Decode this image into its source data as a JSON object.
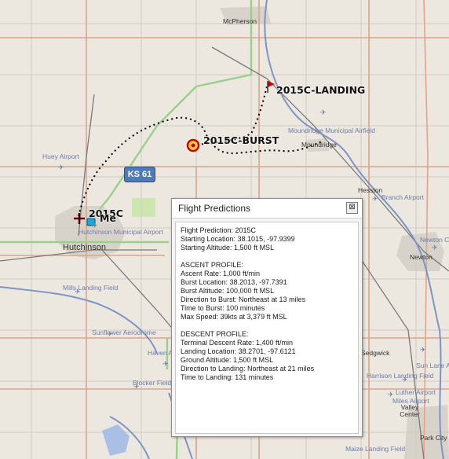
{
  "map": {
    "towns": {
      "mcpherson": "McPherson",
      "hutchinson": "Hutchinson",
      "hesston": "Hesston",
      "newton": "Newton",
      "moundridge": "Moundridge",
      "sedgwick": "Sedgwick",
      "valley_center": "Valley Center",
      "park_city": "Park City"
    },
    "airports": {
      "moundridge": "Moundridge Municipal Airfield",
      "huey": "Huey Airport",
      "hutchinson": "Hutchinson Municipal Airport",
      "mills": "Mills Landing Field",
      "sunflower": "Sunflower Aerodrome",
      "haven": "Haven A",
      "blocker": "Blocker Field",
      "newton_city": "Newton City",
      "sun_lane": "Sun Lane Ai",
      "harrison": "Harrison Landing Field",
      "luther": "Luther Airport",
      "miles": "Miles Airport",
      "maize": "Maize Landing Field",
      "hesston_branch": "Branch Airport"
    },
    "highway_shield": "KS 61",
    "markers": {
      "launch": "2015C",
      "me": "Me",
      "burst": "2015C-BURST",
      "landing": "2015C-LANDING"
    },
    "colors": {
      "background": "#ece7df",
      "river": "#7b95c6",
      "rail": "#7a7a7a",
      "highway": "#9bd08a",
      "road": "#e0a48a",
      "section_road": "#cfcbc3",
      "town_area": "#d4cfc5",
      "flight_path": "#000000",
      "burst_marker": "#e00000",
      "landing_flag": "#cc0000"
    }
  },
  "panel": {
    "title": "Flight Predictions",
    "close_label": "⊠",
    "lines": [
      "Flight Prediction: 2015C",
      "Starting Location: 38.1015, -97.9399",
      "Starting Altitude: 1,500 ft MSL",
      "",
      "ASCENT PROFILE:",
      "Ascent Rate: 1,000 ft/min",
      "Burst Location: 38.2013, -97.7391",
      "Burst Altitude: 100,000 ft MSL",
      "Direction to Burst: Northeast at 13 miles",
      "Time to Burst: 100 minutes",
      "Max Speed: 39kts at 3,379 ft MSL",
      "",
      "DESCENT PROFILE:",
      "Terminal Descent Rate: 1,400 ft/min",
      "Landing Location: 38.2701, -97.6121",
      "Ground Altitude: 1,500 ft MSL",
      "Direction to Landing: Northeast at 21 miles",
      "Time to Landing: 131 minutes"
    ]
  }
}
